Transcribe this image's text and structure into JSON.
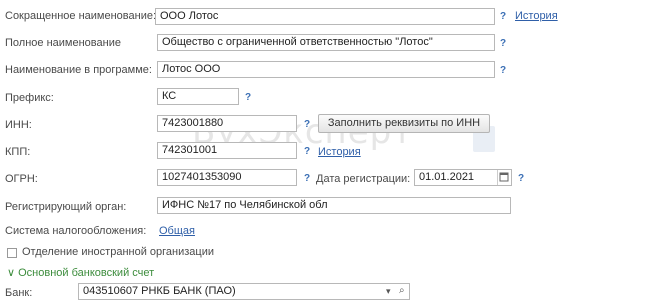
{
  "form": {
    "short_name_label": "Сокращенное наименование:",
    "short_name_value": "ООО Лотос",
    "full_name_label": "Полное наименование",
    "full_name_value": "Общество с ограниченной ответственностью \"Лотос\"",
    "program_name_label": "Наименование в программе:",
    "program_name_value": "Лотос ООО",
    "prefix_label": "Префикс:",
    "prefix_value": "КС",
    "inn_label": "ИНН:",
    "inn_value": "7423001880",
    "fill_by_inn_button": "Заполнить реквизиты по ИНН",
    "kpp_label": "КПП:",
    "kpp_value": "742301001",
    "ogrn_label": "ОГРН:",
    "ogrn_value": "1027401353090",
    "reg_date_label": "Дата регистрации:",
    "reg_date_value": "01.01.2021",
    "reg_authority_label": "Регистрирующий орган:",
    "reg_authority_value": "ИФНС №17 по Челябинской обл",
    "tax_system_label": "Система налогообложения:",
    "tax_system_link": "Общая",
    "foreign_org_label": "Отделение иностранной организации",
    "bank_section_label": "Основной банковский счет",
    "bank_label": "Банк:",
    "bank_value": "043510607 РНКБ БАНК (ПАО)",
    "history_link": "История",
    "help_mark": "?"
  },
  "watermark": {
    "text": "БухЭксперт"
  },
  "colors": {
    "link": "#2f5fa8",
    "section": "#3c8c3c",
    "border": "#b8b8b8"
  }
}
